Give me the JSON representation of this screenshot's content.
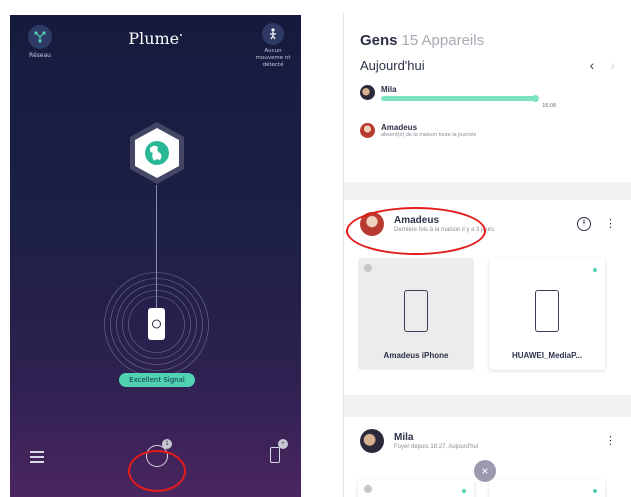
{
  "left_app": {
    "network_label": "Réseau",
    "logo": "Plume",
    "logo_mark": "•",
    "motion_label": "Aucun mouveme nt détecté",
    "signal_badge": "Excellent Signal",
    "center_badge": "1",
    "device_badge": "+",
    "icons": {
      "network": "network-icon",
      "motion": "person-motion-icon",
      "pod": "globe-pod-icon",
      "menu": "menu-icon",
      "advisor": "advisor-icon",
      "device": "phone-device-icon"
    },
    "colors": {
      "accent": "#4fd1b2",
      "background_top": "#161b3e",
      "background_bottom": "#4b2660"
    }
  },
  "right_app": {
    "title": "Gens",
    "title_sub": "15 Appareils",
    "period": "Aujourd'hui",
    "prev_arrow": "‹",
    "next_arrow": "›",
    "timeline": [
      {
        "name": "Mila",
        "time": "16:08",
        "presence_fraction": 0.88
      },
      {
        "name": "Amadeus",
        "note": "absent(e) de la maison toute la journée"
      }
    ],
    "people": [
      {
        "name": "Amadeus",
        "status": "Dernière fois à la maison il y a 3 jours",
        "pause": "II",
        "menu": "⋮",
        "devices": [
          {
            "label": "Amadeus iPhone",
            "online": false
          },
          {
            "label": "HUAWEI_MediaP...",
            "online": true
          }
        ]
      },
      {
        "name": "Mila",
        "status": "Foyer depuis 18:27, Aujourd'hui",
        "menu": "⋮"
      }
    ],
    "close_fab": "×",
    "colors": {
      "progress": "#7ee3c2",
      "online_dot": "#4fd1b2",
      "text": "#2c3148"
    }
  }
}
